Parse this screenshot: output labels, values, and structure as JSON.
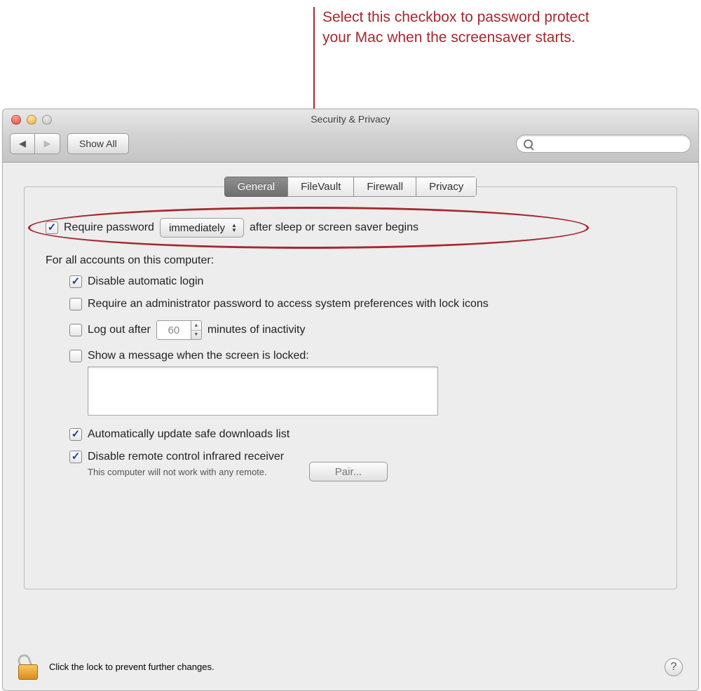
{
  "callout_text": "Select this checkbox to password protect your Mac when the screensaver starts.",
  "window": {
    "title": "Security & Privacy",
    "show_all_label": "Show All",
    "search_placeholder": ""
  },
  "tabs": {
    "general": "General",
    "filevault": "FileVault",
    "firewall": "Firewall",
    "privacy": "Privacy"
  },
  "general": {
    "require_password_prefix": "Require password",
    "require_password_delay": "immediately",
    "require_password_suffix": "after sleep or screen saver begins",
    "accounts_heading": "For all accounts on this computer:",
    "disable_auto_login": "Disable automatic login",
    "require_admin": "Require an administrator password to access system preferences with lock icons",
    "logout_prefix": "Log out after",
    "logout_minutes": "60",
    "logout_suffix": "minutes of inactivity",
    "show_message": "Show a message when the screen is locked:",
    "lock_message_value": "",
    "auto_update_list": "Automatically update safe downloads list",
    "disable_ir": "Disable remote control infrared receiver",
    "ir_note": "This computer will not work with any remote.",
    "pair_button": "Pair..."
  },
  "footer": {
    "lock_text": "Click the lock to prevent further changes.",
    "help_label": "?"
  }
}
